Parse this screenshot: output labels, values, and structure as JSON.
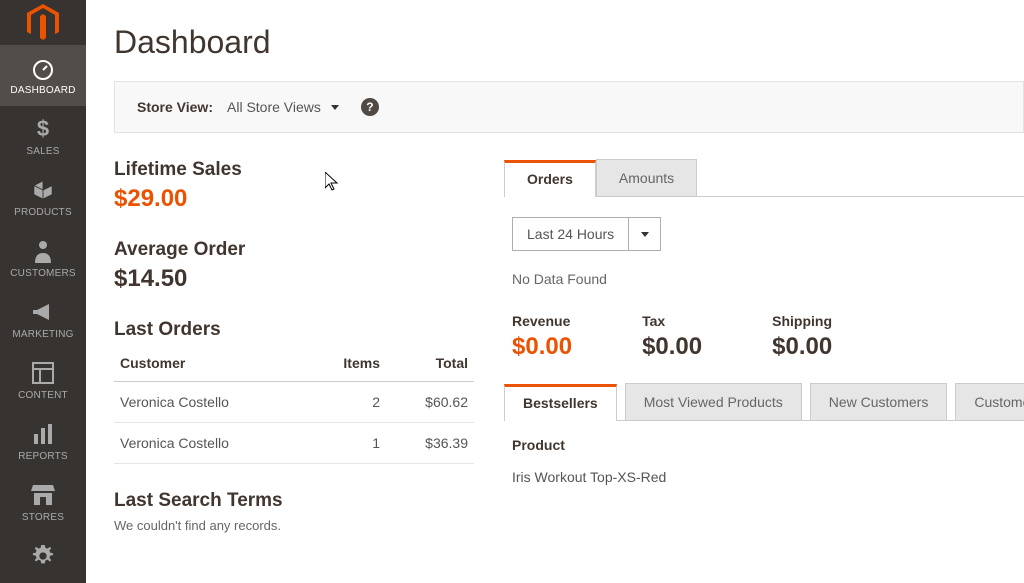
{
  "page_title": "Dashboard",
  "sidebar": {
    "items": [
      {
        "label": "DASHBOARD",
        "icon": "dashboard-icon",
        "active": true
      },
      {
        "label": "SALES",
        "icon": "sales-icon"
      },
      {
        "label": "PRODUCTS",
        "icon": "products-icon"
      },
      {
        "label": "CUSTOMERS",
        "icon": "customers-icon"
      },
      {
        "label": "MARKETING",
        "icon": "marketing-icon"
      },
      {
        "label": "CONTENT",
        "icon": "content-icon"
      },
      {
        "label": "REPORTS",
        "icon": "reports-icon"
      },
      {
        "label": "STORES",
        "icon": "stores-icon"
      },
      {
        "label": "SYSTEM",
        "icon": "system-icon"
      }
    ]
  },
  "store_view": {
    "label": "Store View:",
    "value": "All Store Views",
    "help": "?"
  },
  "stats": {
    "lifetime_sales": {
      "title": "Lifetime Sales",
      "value": "$29.00"
    },
    "average_order": {
      "title": "Average Order",
      "value": "$14.50"
    }
  },
  "last_orders": {
    "title": "Last Orders",
    "headers": {
      "customer": "Customer",
      "items": "Items",
      "total": "Total"
    },
    "rows": [
      {
        "customer": "Veronica Costello",
        "items": "2",
        "total": "$60.62"
      },
      {
        "customer": "Veronica Costello",
        "items": "1",
        "total": "$36.39"
      }
    ]
  },
  "last_search": {
    "title": "Last Search Terms",
    "empty": "We couldn't find any records."
  },
  "chart_tabs": {
    "orders": "Orders",
    "amounts": "Amounts"
  },
  "filter": {
    "selected": "Last 24 Hours"
  },
  "no_data": "No Data Found",
  "metrics": {
    "revenue": {
      "label": "Revenue",
      "value": "$0.00"
    },
    "tax": {
      "label": "Tax",
      "value": "$0.00"
    },
    "shipping": {
      "label": "Shipping",
      "value": "$0.00"
    }
  },
  "product_tabs": {
    "bestsellers": "Bestsellers",
    "most_viewed": "Most Viewed Products",
    "new_customers": "New Customers",
    "customers": "Customers"
  },
  "product_table": {
    "header": "Product",
    "rows": [
      "Iris Workout Top-XS-Red"
    ]
  }
}
